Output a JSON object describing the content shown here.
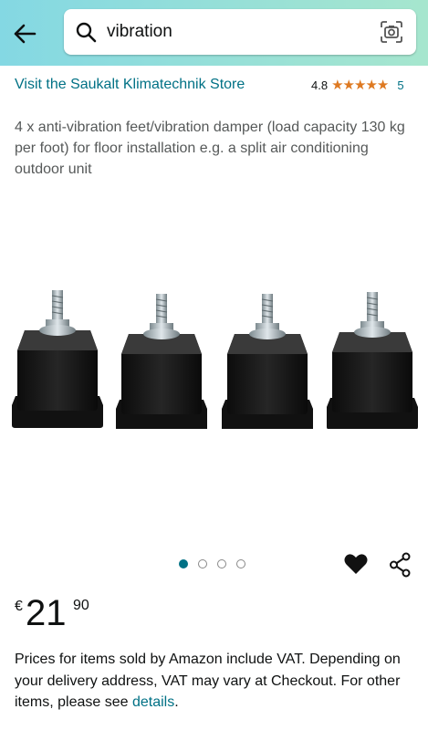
{
  "search": {
    "query": "vibration"
  },
  "product": {
    "store_link": "Visit the Saukalt Klimatechnik Store",
    "rating_value": "4.8",
    "rating_stars": 5,
    "rating_count": "5",
    "title": "4 x anti-vibration feet/vibration damper (load capacity 130 kg per foot) for floor installation e.g. a split air conditioning outdoor unit",
    "image_count": 4,
    "active_image": 1
  },
  "price": {
    "symbol": "€",
    "whole": "21",
    "fraction": "90"
  },
  "vat": {
    "text": "Prices for items sold by Amazon include VAT. Depending on your delivery address, VAT may vary at Checkout. For other items, please see ",
    "link": "details",
    "end": "."
  },
  "colors": {
    "link": "#007185",
    "star": "#de7921",
    "header_start": "#84d8e3",
    "header_end": "#a6e6ce"
  }
}
